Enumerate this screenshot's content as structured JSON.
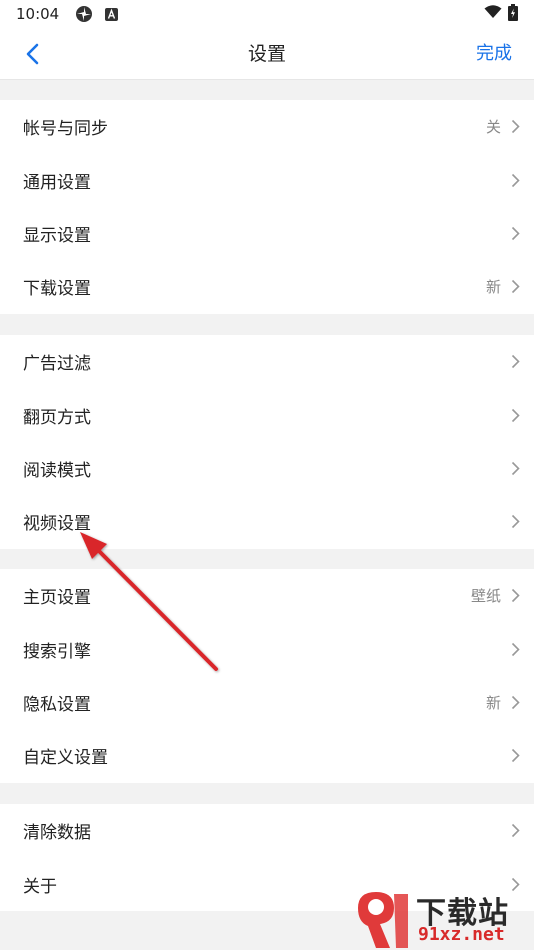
{
  "status_bar": {
    "time": "10:04",
    "icons_left": [
      "pinwheel-icon",
      "a-badge-icon"
    ],
    "icons_right": [
      "wifi-icon",
      "battery-icon"
    ]
  },
  "nav": {
    "back_icon": "chevron-left-icon",
    "title": "设置",
    "done_label": "完成"
  },
  "groups": [
    {
      "items": [
        {
          "label": "帐号与同步",
          "value": "关"
        },
        {
          "label": "通用设置",
          "value": ""
        },
        {
          "label": "显示设置",
          "value": ""
        },
        {
          "label": "下载设置",
          "value": "新"
        }
      ]
    },
    {
      "items": [
        {
          "label": "广告过滤",
          "value": ""
        },
        {
          "label": "翻页方式",
          "value": ""
        },
        {
          "label": "阅读模式",
          "value": ""
        },
        {
          "label": "视频设置",
          "value": ""
        }
      ]
    },
    {
      "items": [
        {
          "label": "主页设置",
          "value": "壁纸"
        },
        {
          "label": "搜索引擎",
          "value": ""
        },
        {
          "label": "隐私设置",
          "value": "新"
        },
        {
          "label": "自定义设置",
          "value": ""
        }
      ]
    },
    {
      "items": [
        {
          "label": "清除数据",
          "value": ""
        },
        {
          "label": "关于",
          "value": ""
        }
      ]
    }
  ],
  "annotation": {
    "color": "#d9262b",
    "points_to": "视频设置"
  },
  "watermark": {
    "logo_text": "9",
    "title": "下载站",
    "url": "91xz.net"
  },
  "colors": {
    "accent": "#1a73e8",
    "background": "#f2f2f2",
    "card": "#ffffff",
    "secondary_text": "#888888"
  }
}
